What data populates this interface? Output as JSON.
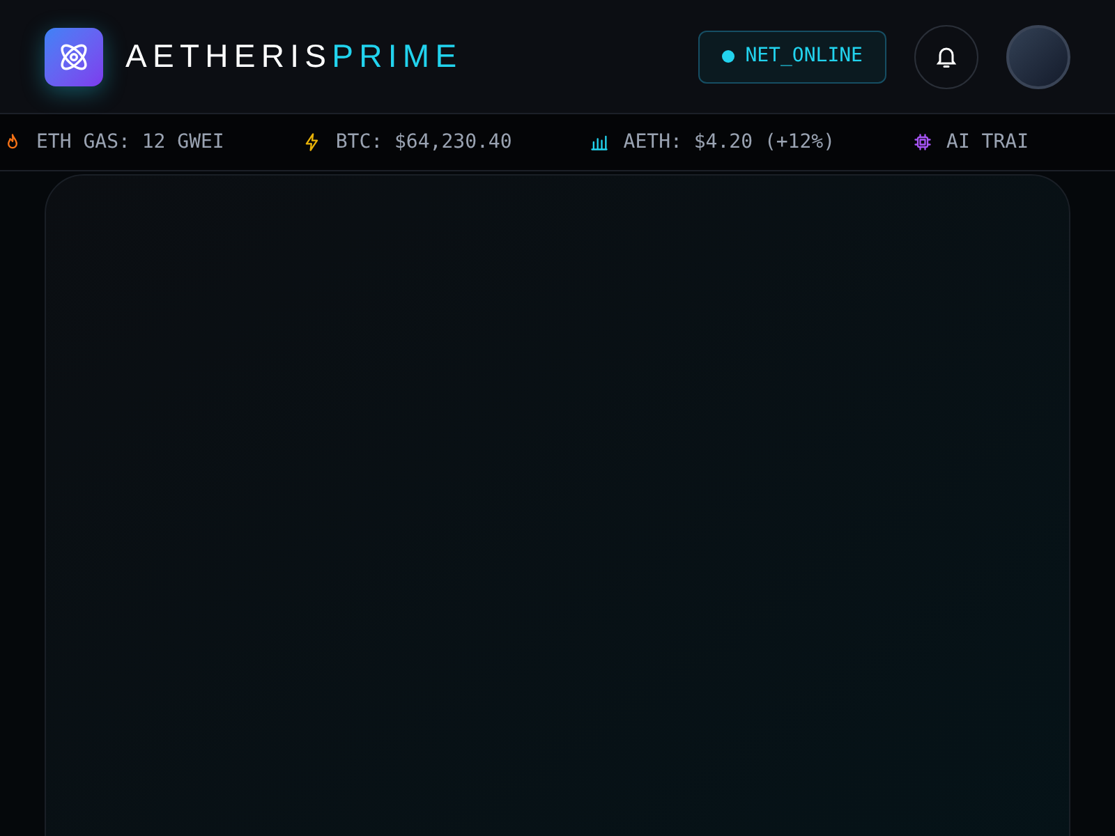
{
  "brand": {
    "name": "AETHERIS",
    "accent": "PRIME"
  },
  "status": {
    "label": "NET_ONLINE",
    "color": "#22d3ee"
  },
  "ticker": [
    {
      "kind": "flame",
      "text": "ETH GAS: 12 GWEI"
    },
    {
      "kind": "bolt",
      "text": "BTC: $64,230.40"
    },
    {
      "kind": "bars",
      "text": "AETH: $4.20 (+12%)"
    },
    {
      "kind": "chip",
      "text": "AI TRAI"
    }
  ]
}
